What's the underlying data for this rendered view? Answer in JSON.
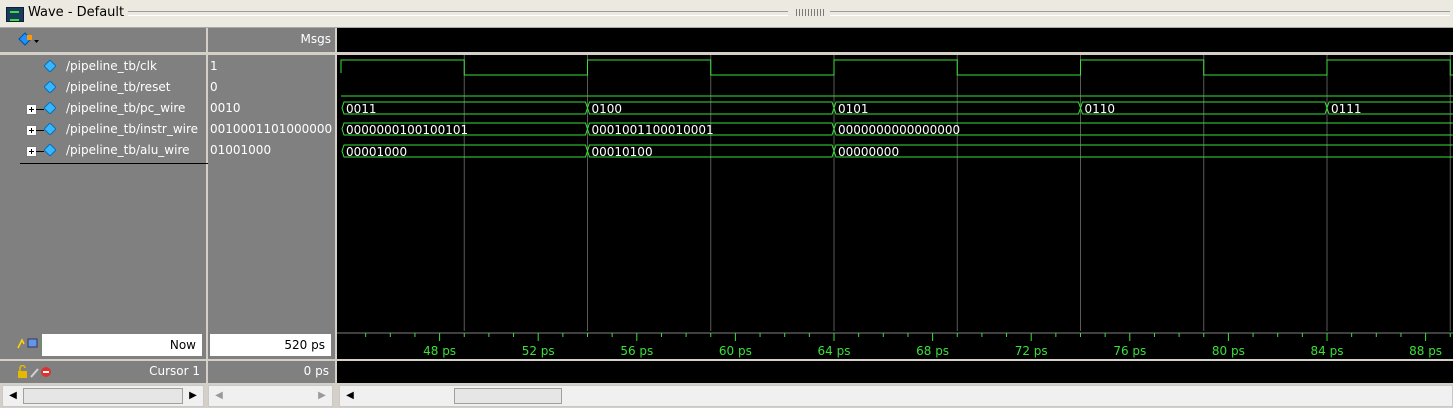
{
  "window": {
    "title": "Wave - Default"
  },
  "header": {
    "msgs_label": "Msgs"
  },
  "signals": [
    {
      "name": "/pipeline_tb/clk",
      "value": "1",
      "expandable": false
    },
    {
      "name": "/pipeline_tb/reset",
      "value": "0",
      "expandable": false
    },
    {
      "name": "/pipeline_tb/pc_wire",
      "value": "0010",
      "expandable": true
    },
    {
      "name": "/pipeline_tb/instr_wire",
      "value": "0010001101000000",
      "expandable": true
    },
    {
      "name": "/pipeline_tb/alu_wire",
      "value": "01001000",
      "expandable": true
    }
  ],
  "waves": {
    "pc_wire": [
      {
        "t": 44,
        "v": "0011"
      },
      {
        "t": 54,
        "v": "0100"
      },
      {
        "t": 64,
        "v": "0101"
      },
      {
        "t": 74,
        "v": "0110"
      },
      {
        "t": 84,
        "v": "0111"
      }
    ],
    "instr_wire": [
      {
        "t": 44,
        "v": "0000000100100101"
      },
      {
        "t": 54,
        "v": "0001001100010001"
      },
      {
        "t": 64,
        "v": "0000000000000000"
      }
    ],
    "alu_wire": [
      {
        "t": 44,
        "v": "00001000"
      },
      {
        "t": 54,
        "v": "00010100"
      },
      {
        "t": 64,
        "v": "00000000"
      }
    ],
    "clk_period_ps": 10,
    "view_start_ps": 44,
    "view_end_ps": 89.3
  },
  "timeline": {
    "ticks": [
      "48 ps",
      "52 ps",
      "56 ps",
      "60 ps",
      "64 ps",
      "68 ps",
      "72 ps",
      "76 ps",
      "80 ps",
      "84 ps",
      "88 ps"
    ],
    "now_label": "Now",
    "now_value": "520 ps",
    "cursor_label": "Cursor 1",
    "cursor_value": "0 ps"
  },
  "colors": {
    "wave": "#39e039",
    "background": "#000000",
    "panel": "#808080",
    "grid": "#5a5a5a"
  },
  "icons": [
    "wave-window-icon",
    "add-signal-icon",
    "signal-diamond-icon",
    "expand-plus-icon",
    "now-icons",
    "cursor-icons"
  ]
}
